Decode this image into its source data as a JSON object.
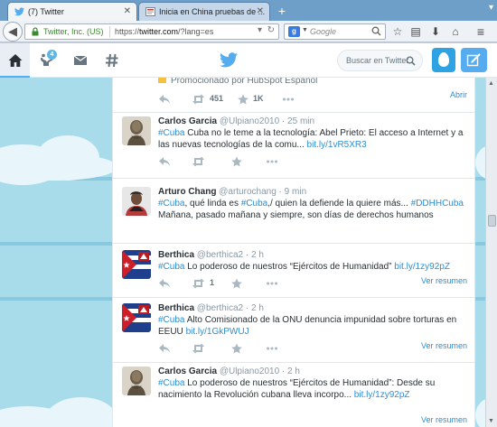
{
  "browser": {
    "tabs": [
      {
        "title": "(7) Twitter",
        "active": true
      },
      {
        "title": "Inicia en China pruebas de ...",
        "active": false
      }
    ],
    "new_tab_symbol": "+",
    "url_org": "Twitter, Inc. (US)",
    "url_host": "twitter.com",
    "url_rest": "/?lang=es",
    "url_prefix": "https://",
    "search_engine_icon": "google-icon",
    "search_placeholder": "Google"
  },
  "twitter": {
    "nav": [
      {
        "name": "home",
        "icon": "home-icon",
        "active": true
      },
      {
        "name": "notifications",
        "icon": "notifications-icon",
        "badge": "4"
      },
      {
        "name": "messages",
        "icon": "envelope-icon"
      },
      {
        "name": "discover",
        "icon": "hashtag-icon"
      }
    ],
    "search_placeholder": "Buscar en Twitter",
    "accent": "#55acee"
  },
  "stream": {
    "promo": {
      "text": "Promocionado por HubSpot Español",
      "retweets": "451",
      "favorites": "1K",
      "expand_label": "Abrir"
    },
    "tweets": [
      {
        "name": "Carlos Garcia",
        "handle": "@Ulpiano2010",
        "time": "25 min",
        "parts": [
          {
            "t": "#Cuba",
            "k": "tag"
          },
          {
            "t": " Cuba no le teme a la tecnología: Abel Prieto: El acceso a Internet y a las nuevas tecnologías de la comu... ",
            "k": ""
          },
          {
            "t": "bit.ly/1vR5XR3",
            "k": "lnk"
          }
        ],
        "retweets": "",
        "expand_label": ""
      },
      {
        "name": "Arturo Chang",
        "handle": "@arturochang",
        "time": "9 min",
        "parts": [
          {
            "t": "#Cuba",
            "k": "tag"
          },
          {
            "t": ", qué linda es ",
            "k": ""
          },
          {
            "t": "#Cuba",
            "k": "tag"
          },
          {
            "t": ",/ quien la defiende la quiere más... ",
            "k": ""
          },
          {
            "t": "#DDHHCuba",
            "k": "tag"
          },
          {
            "t": " Mañana, pasado mañana y siempre, son días de derechos humanos",
            "k": ""
          }
        ],
        "retweets": "",
        "expand_label": ""
      },
      {
        "name": "Berthica",
        "handle": "@berthica2",
        "time": "2 h",
        "parts": [
          {
            "t": "#Cuba",
            "k": "tag"
          },
          {
            "t": " Lo poderoso de nuestros “Ejércitos de Humanidad” ",
            "k": ""
          },
          {
            "t": "bit.ly/1zy92pZ",
            "k": "lnk"
          }
        ],
        "retweets": "1",
        "expand_label": "Ver resumen"
      },
      {
        "name": "Berthica",
        "handle": "@berthica2",
        "time": "2 h",
        "parts": [
          {
            "t": "#Cuba",
            "k": "tag"
          },
          {
            "t": " Alto Comisionado de la ONU denuncia impunidad sobre torturas en EEUU ",
            "k": ""
          },
          {
            "t": "bit.ly/1GkPWUJ",
            "k": "lnk"
          }
        ],
        "retweets": "",
        "expand_label": "Ver resumen"
      },
      {
        "name": "Carlos Garcia",
        "handle": "@Ulpiano2010",
        "time": "2 h",
        "parts": [
          {
            "t": "#Cuba",
            "k": "tag"
          },
          {
            "t": " Lo poderoso de nuestros “Ejércitos de Humanidad”: Desde su nacimiento la Revolución cubana lleva incorpo... ",
            "k": ""
          },
          {
            "t": "bit.ly/1zy92pZ",
            "k": "lnk"
          }
        ],
        "retweets": "",
        "expand_label": "Ver resumen"
      }
    ]
  }
}
